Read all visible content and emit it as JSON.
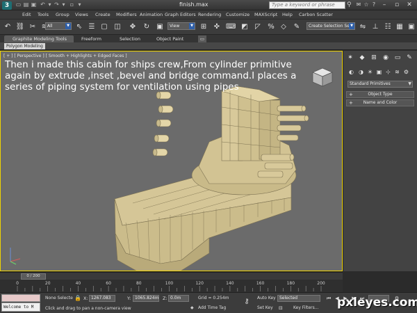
{
  "titlebar": {
    "title": "finish.max",
    "search_placeholder": "Type a keyword or phrase"
  },
  "menu": [
    "Edit",
    "Tools",
    "Group",
    "Views",
    "Create",
    "Modifiers",
    "Animation",
    "Graph Editors",
    "Rendering",
    "Customize",
    "MAXScript",
    "Help",
    "Carbon Scatter"
  ],
  "toolbar": {
    "selection_filter": "All",
    "reference_coord": "View",
    "named_selection": "Create Selection Se"
  },
  "ribbon": {
    "tabs": [
      "Graphite Modeling Tools",
      "Freeform",
      "Selection",
      "Object Paint"
    ],
    "panel_label": "Polygon Modeling"
  },
  "viewport": {
    "label": "[ + ] [ Perspective ] [ Smooth + Highlights + Edged Faces ]",
    "caption": "Then i made this cabin for ships crew,From cylinder primitive again by extrude ,inset ,bevel and bridge command.I places a series of piping system for ventilation using pipes"
  },
  "command_panel": {
    "category": "Standard Primitives",
    "rollouts": [
      "Object Type",
      "Name and Color"
    ]
  },
  "timeline": {
    "frame_readout": "0 / 200",
    "ticks": [
      "0",
      "20",
      "40",
      "60",
      "80",
      "100",
      "120",
      "140",
      "160",
      "180",
      "200"
    ]
  },
  "status": {
    "selection": "None Selecte",
    "x_label": "X:",
    "x_value": "1267.083",
    "y_label": "Y:",
    "y_value": "1065.824m",
    "z_label": "Z:",
    "z_value": "0.0m",
    "grid": "Grid = 0.254m",
    "prompt": "Click and drag to pan a non-camera view",
    "add_time_tag": "Add Time Tag",
    "auto_key": "Auto Key",
    "set_key": "Set Key",
    "key_mode": "Selected",
    "key_filters": "Key Filters...",
    "listener": "Welcome to M"
  },
  "watermark": "pxleyes.com",
  "colors": {
    "viewport_bg": "#6b6b6b",
    "active_border": "#f0d400",
    "model_face": "#d8c99a",
    "model_shadow": "#9c8f66"
  }
}
